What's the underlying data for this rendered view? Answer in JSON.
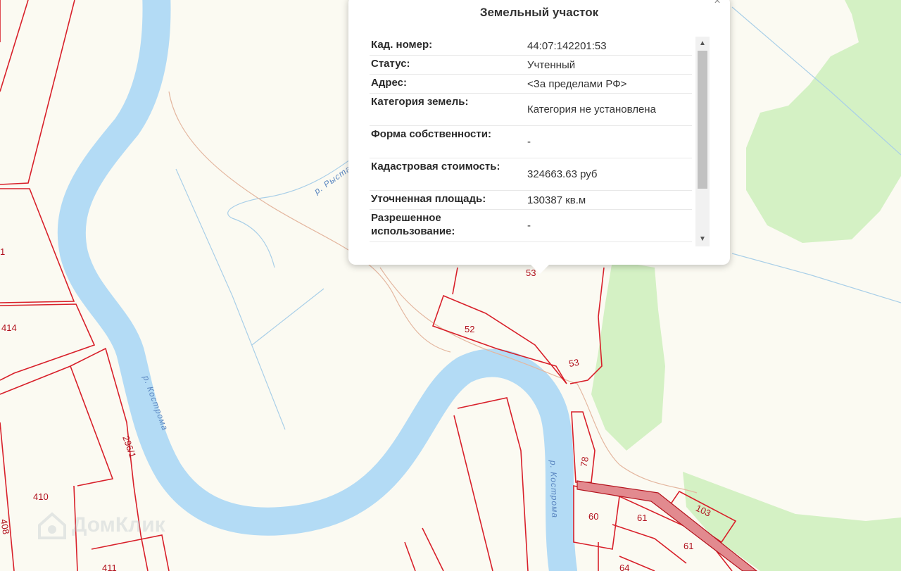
{
  "popup": {
    "title": "Земельный участок",
    "rows": [
      {
        "key": "Кад. номер:",
        "value": "44:07:142201:53"
      },
      {
        "key": "Статус:",
        "value": "Учтенный"
      },
      {
        "key": "Адрес:",
        "value": "<За пределами РФ>"
      },
      {
        "key": "Категория земель:",
        "value": "Категория не установлена"
      },
      {
        "key": "Форма собственности:",
        "value": "-"
      },
      {
        "key": "Кадастровая стоимость:",
        "value": "324663.63 руб"
      },
      {
        "key": "Уточненная площадь:",
        "value": "130387 кв.м"
      },
      {
        "key": "Разрешенное использование:",
        "value": "-"
      }
    ],
    "close_icon": "close-icon",
    "scroll_up_icon": "chevron-up-icon",
    "scroll_down_icon": "chevron-down-icon"
  },
  "map": {
    "parcel_labels": [
      "414",
      "410",
      "411",
      "296/1",
      "1",
      "408",
      "52",
      "53",
      "53",
      "78",
      "60",
      "61",
      "61",
      "103",
      "64"
    ],
    "river_labels": [
      "р. Кострома",
      "р. Кострома",
      "р. Рыста"
    ],
    "colors": {
      "background": "#fbfaf2",
      "river": "#b3dbf5",
      "forest": "#d4f1c4",
      "parcel_border": "#d8202a",
      "road": "#e28a8f"
    }
  },
  "watermark": {
    "text": "ДомКлик",
    "icon": "house-logo-icon"
  }
}
